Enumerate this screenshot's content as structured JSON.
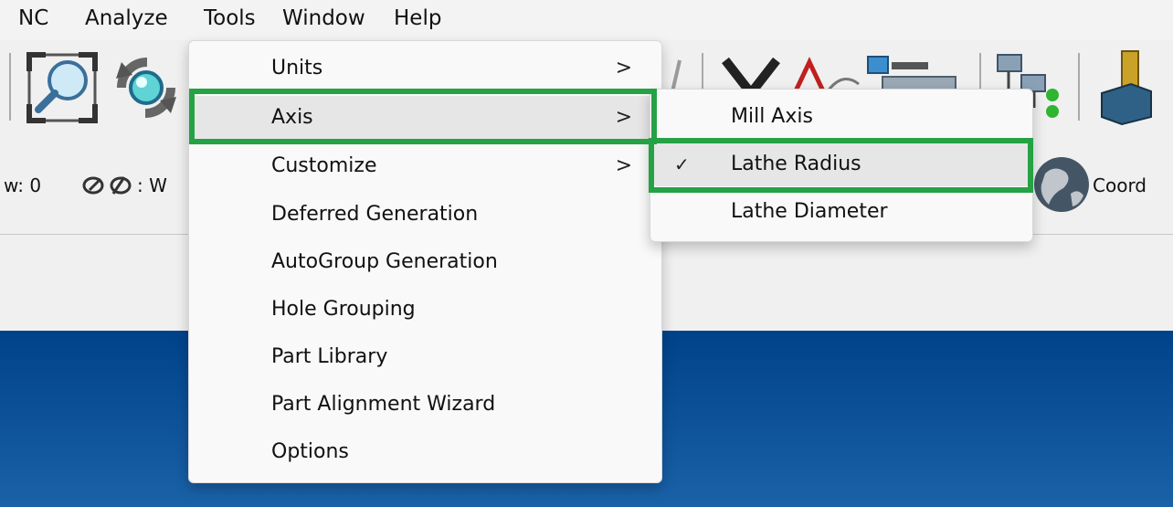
{
  "menubar": {
    "items": [
      "NC",
      "Analyze",
      "Tools",
      "Window",
      "Help"
    ]
  },
  "status_bar": {
    "view_text": "w: 0",
    "w_text": ": W",
    "coord_text": "Coord"
  },
  "tools_menu": {
    "items": [
      {
        "label": "Units",
        "has_submenu": true
      },
      {
        "label": "Axis",
        "has_submenu": true,
        "highlighted": true
      },
      {
        "label": "Customize",
        "has_submenu": true
      },
      {
        "label": "Deferred Generation",
        "has_submenu": false
      },
      {
        "label": "AutoGroup Generation",
        "has_submenu": false
      },
      {
        "label": "Hole Grouping",
        "has_submenu": false
      },
      {
        "label": "Part Library",
        "has_submenu": false
      },
      {
        "label": "Part Alignment Wizard",
        "has_submenu": false
      },
      {
        "label": "Options",
        "has_submenu": false
      }
    ],
    "arrow_glyph": ">"
  },
  "axis_submenu": {
    "items": [
      {
        "label": "Mill Axis",
        "checked": false
      },
      {
        "label": "Lathe Radius",
        "checked": true
      },
      {
        "label": "Lathe Diameter",
        "checked": false
      }
    ],
    "check_glyph": "✓"
  },
  "colors": {
    "annotation": "#25a244",
    "viewport": "#00428a"
  }
}
